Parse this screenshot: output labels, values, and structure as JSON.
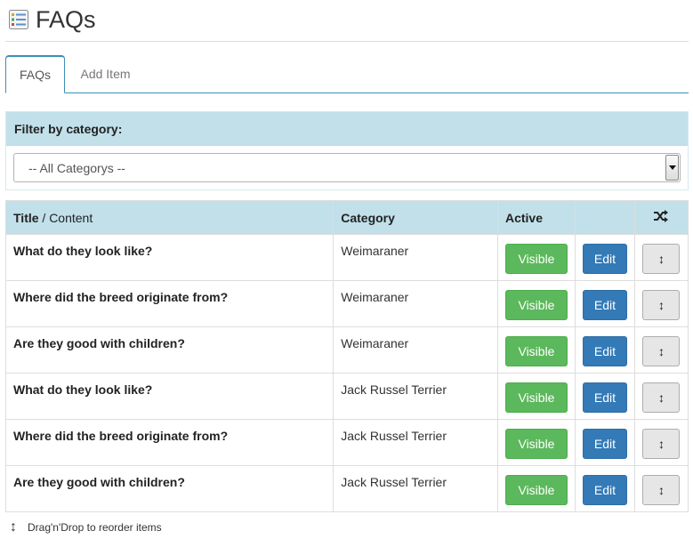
{
  "page": {
    "title": "FAQs",
    "icon": "list-icon"
  },
  "tabs": [
    {
      "label": "FAQs",
      "active": true
    },
    {
      "label": "Add Item",
      "active": false
    }
  ],
  "filter": {
    "label": "Filter by category:",
    "selected": "-- All Categorys --"
  },
  "table": {
    "headers": {
      "title": "Title",
      "title_sep": " / Content",
      "category": "Category",
      "active": "Active",
      "reorder_icon": "shuffle-icon"
    },
    "rows": [
      {
        "title": "What do they look like?",
        "category": "Weimaraner",
        "visible_label": "Visible",
        "edit_label": "Edit"
      },
      {
        "title": "Where did the breed originate from?",
        "category": "Weimaraner",
        "visible_label": "Visible",
        "edit_label": "Edit"
      },
      {
        "title": "Are they good with children?",
        "category": "Weimaraner",
        "visible_label": "Visible",
        "edit_label": "Edit"
      },
      {
        "title": "What do they look like?",
        "category": "Jack Russel Terrier",
        "visible_label": "Visible",
        "edit_label": "Edit"
      },
      {
        "title": "Where did the breed originate from?",
        "category": "Jack Russel Terrier",
        "visible_label": "Visible",
        "edit_label": "Edit"
      },
      {
        "title": "Are they good with children?",
        "category": "Jack Russel Terrier",
        "visible_label": "Visible",
        "edit_label": "Edit"
      }
    ]
  },
  "footer": {
    "note": "Drag'n'Drop to reorder items"
  },
  "colors": {
    "header_bg": "#c1e0ea",
    "visible_btn": "#5cb85c",
    "edit_btn": "#337ab7",
    "tab_border": "#3a8fb7"
  }
}
